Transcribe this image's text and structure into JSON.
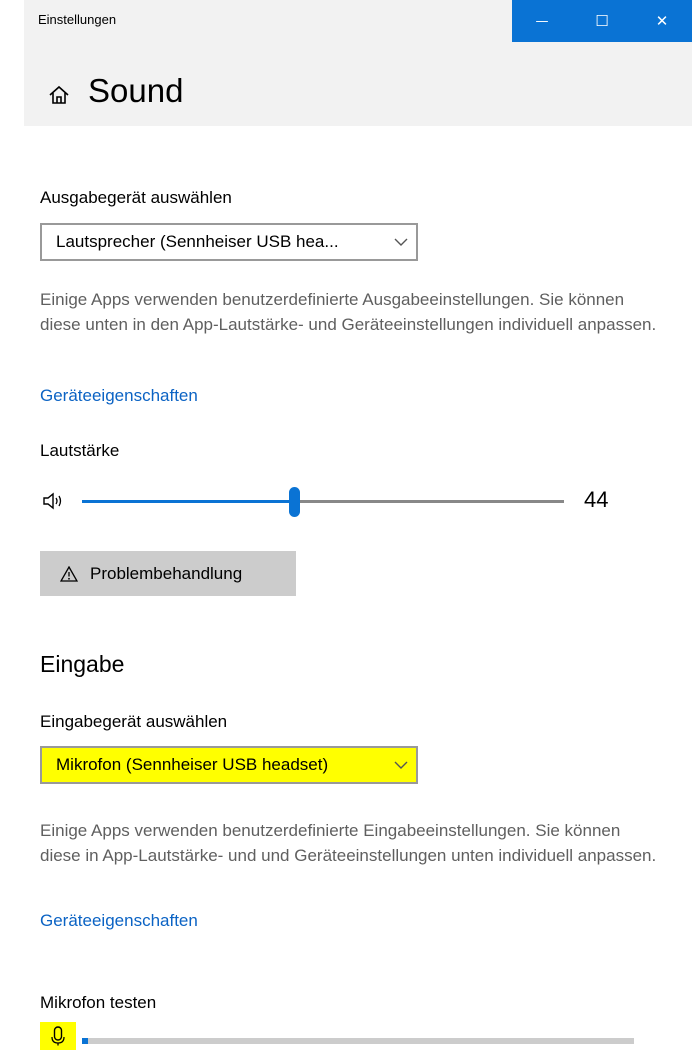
{
  "window": {
    "app_title": "Einstellungen",
    "minimize_glyph": "—",
    "maximize_glyph": "☐",
    "close_glyph": "✕",
    "accent": "#0a73d4"
  },
  "header": {
    "icon": "home-icon",
    "title": "Sound"
  },
  "output": {
    "select_label": "Ausgabegerät auswählen",
    "device_value": "Lautsprecher (Sennheiser USB hea...",
    "description": "Einige Apps verwenden benutzerdefinierte Ausgabeeinstellungen. Sie können diese unten in den App-Lautstärke- und Geräteeinstellungen individuell anpassen.",
    "properties_link": "Geräteeigenschaften",
    "volume_label": "Lautstärke",
    "volume_icon": "speaker-icon",
    "volume_value": "44",
    "volume_level": 44,
    "troubleshoot_icon": "warning-icon",
    "troubleshoot_label": "Problembehandlung"
  },
  "input": {
    "section_title": "Eingabe",
    "select_label": "Eingabegerät auswählen",
    "device_value": "Mikrofon (Sennheiser USB headset)",
    "highlight_color": "#ffff00",
    "description": "Einige Apps verwenden benutzerdefinierte Eingabeeinstellungen. Sie können diese in App-Lautstärke- und und Geräteeinstellungen unten individuell anpassen.",
    "properties_link": "Geräteeigenschaften",
    "test_label": "Mikrofon testen",
    "mic_icon": "microphone-icon",
    "mic_level": 1
  }
}
